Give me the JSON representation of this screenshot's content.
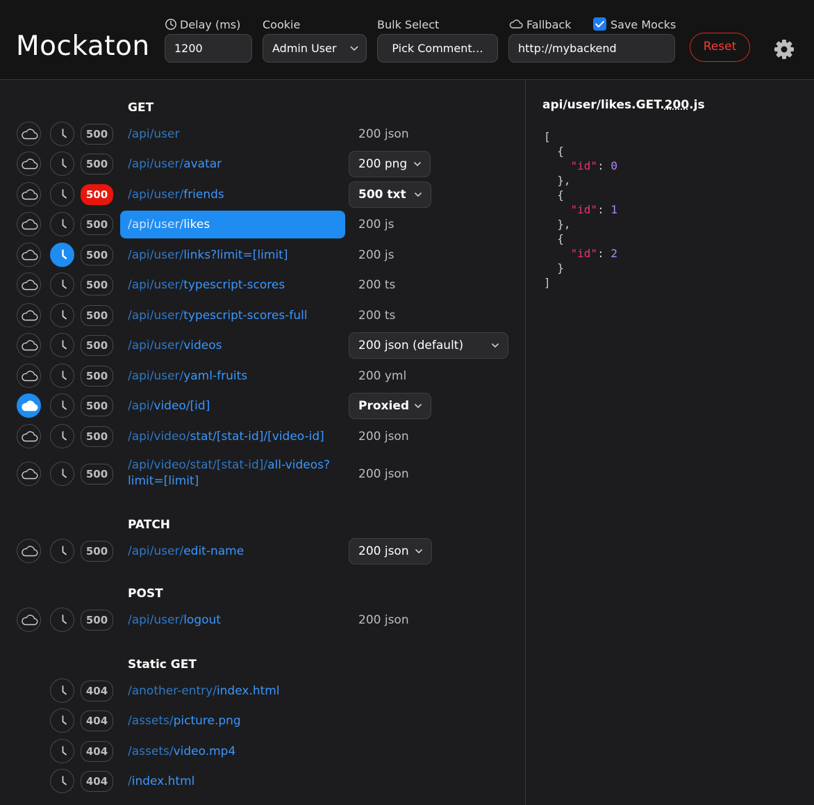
{
  "header": {
    "logo": "Mockaton",
    "delay": {
      "label": "Delay (ms)",
      "value": "1200"
    },
    "cookie": {
      "label": "Cookie",
      "value": "Admin User"
    },
    "bulk_select": {
      "label": "Bulk Select",
      "value": "Pick Comment…"
    },
    "fallback": {
      "label": "Fallback",
      "value": "http://mybackend"
    },
    "save_mocks": {
      "label": "Save Mocks",
      "checked": true
    },
    "reset_label": "Reset"
  },
  "sections": {
    "get": {
      "title": "GET",
      "rows": [
        {
          "prefix": "/api/user",
          "path": "",
          "mock": "200 json"
        },
        {
          "prefix": "/api/user/",
          "path": "avatar",
          "mock": "200 png"
        },
        {
          "prefix": "/api/user/",
          "path": "friends",
          "mock": "500 txt",
          "code": "500"
        },
        {
          "prefix": "/api/user/",
          "path": "likes",
          "mock": "200 js"
        },
        {
          "prefix": "/api/user/",
          "path": "links?limit=[limit]",
          "mock": "200 js"
        },
        {
          "prefix": "/api/user/",
          "path": "typescript-scores",
          "mock": "200 ts"
        },
        {
          "prefix": "/api/user/",
          "path": "typescript-scores-full",
          "mock": "200 ts"
        },
        {
          "prefix": "/api/user/",
          "path": "videos",
          "mock": "200 json (default)"
        },
        {
          "prefix": "/api/user/",
          "path": "yaml-fruits",
          "mock": "200 yml"
        },
        {
          "prefix": "/api/",
          "path": "video/[id]",
          "mock": "Proxied"
        },
        {
          "prefix": "/api/video/",
          "path": "stat/[stat-id]/[video-id]",
          "mock": "200 json"
        },
        {
          "prefix": "/api/video/stat/[stat-id]/",
          "path": "all-videos?limit=[limit]",
          "mock": "200 json"
        }
      ]
    },
    "patch": {
      "title": "PATCH",
      "rows": [
        {
          "prefix": "/api/user/",
          "path": "edit-name",
          "mock": "200 json"
        }
      ]
    },
    "post": {
      "title": "POST",
      "rows": [
        {
          "prefix": "/api/user/",
          "path": "logout",
          "mock": "200 json"
        }
      ]
    },
    "static": {
      "title": "Static GET",
      "rows": [
        {
          "prefix": "/another-entry/",
          "path": "index.html"
        },
        {
          "prefix": "/assets/",
          "path": "picture.png"
        },
        {
          "prefix": "/assets/",
          "path": "video.mp4"
        },
        {
          "prefix": "/",
          "path": "index.html"
        }
      ]
    }
  },
  "codes": {
    "error": "500",
    "not_found": "404"
  },
  "preview": {
    "title_pre": "api/user/likes.GET.",
    "title_code": "200",
    "title_ext": ".js",
    "json": {
      "l1": "[",
      "l2": "  {",
      "k1": "\"id\"",
      "v1": "0",
      "l4": "  },",
      "l5": "  {",
      "k2": "\"id\"",
      "v2": "1",
      "l7": "  },",
      "l8": "  {",
      "k3": "\"id\"",
      "v3": "2",
      "l10": "  }",
      "l11": "]"
    }
  },
  "colors": {
    "accent": "#1e8cf0",
    "danger": "#e8160c",
    "link": "#3a97ff"
  }
}
